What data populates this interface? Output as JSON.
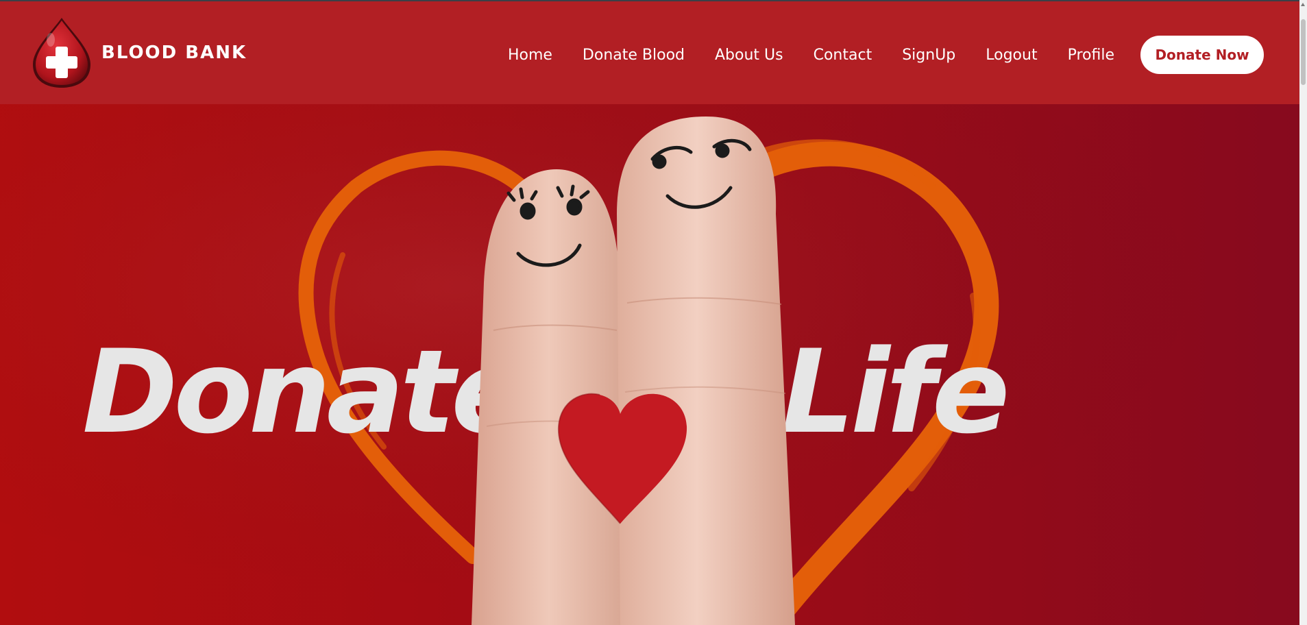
{
  "brand": {
    "name": "BLOOD BANK"
  },
  "nav": {
    "items": [
      {
        "label": "Home"
      },
      {
        "label": "Donate Blood"
      },
      {
        "label": "About Us"
      },
      {
        "label": "Contact"
      },
      {
        "label": "SignUp"
      },
      {
        "label": "Logout"
      },
      {
        "label": "Profile"
      }
    ],
    "cta_label": "Donate Now"
  },
  "hero": {
    "headline_left": "Donate",
    "headline_right": "Life"
  },
  "colors": {
    "navbar": "#b21f24",
    "hero_bg_left": "#b10d0f",
    "hero_bg_right": "#870a1e",
    "heart_stroke": "#e35e09",
    "headline_text": "#e6e6e6"
  }
}
